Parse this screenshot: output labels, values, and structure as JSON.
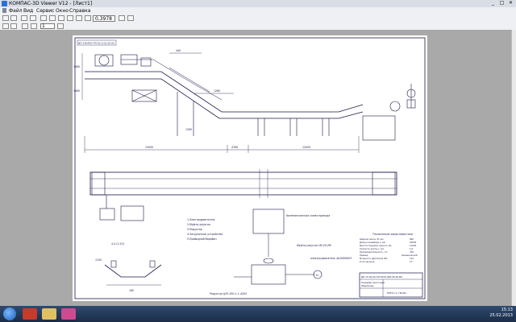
{
  "window": {
    "title": "КОМПАС-3D Viewer V12 - [Лист1]",
    "minimize": "_",
    "maximize": "□",
    "close": "✕"
  },
  "menu": [
    "Файл",
    "Вид",
    "Сервис",
    "Окно",
    "Справка"
  ],
  "toolbar": {
    "zoom": "0,3978",
    "page": "1"
  },
  "drawing": {
    "stamp_top": "ДП-150400-ГМ-01-2.02.00.00",
    "stamp_bottom": "ДП-15.04.00-ГМ-0322.000.00.00.ВО",
    "dims_top": [
      "440",
      "1280"
    ],
    "dims_vert": [
      "1460",
      "1460",
      "1390"
    ],
    "dims_bottom": [
      "13000",
      "4780",
      "12000"
    ],
    "section_label": "4-4 (1:10)",
    "section_width": "160",
    "section_dim2": "1100",
    "kinematic_title": "Кинематическая схема привода",
    "legend": [
      "1.Электродвигатель",
      "2.Муфта-упругая",
      "3.Редуктор",
      "4.Загрузочное устройство",
      "5.Приводной барабан"
    ],
    "labels": {
      "motor": "электродвигатель 4А100М4У3",
      "coupling": "Муфта-упругая 1М-20-2М",
      "reducer": "Редуктор Ц2У-250-1-1-42У4",
      "m": "М"
    },
    "tech_title": "Технические характеристики",
    "tech": [
      [
        "Ширина ленты, В, мм",
        "800"
      ],
      [
        "Длина конвейера L, мм",
        "43000"
      ],
      [
        "Высота подъема груза Н, мм",
        "11000"
      ],
      [
        "Скорость ленты v, м/с",
        "1,6"
      ],
      [
        "Производительность, т/ч",
        "700"
      ],
      [
        "Привод",
        "механический"
      ],
      [
        "Мощность двигателя кВт",
        "110"
      ],
      [
        "Угол наклона",
        "17°"
      ]
    ],
    "stamp_lines": [
      "Конвейер ленточный",
      "Общий вид"
    ],
    "stamp_org": "БГИТА гр. ГМ-022"
  },
  "tray": {
    "time": "15:13",
    "date": "25.02.2013"
  }
}
